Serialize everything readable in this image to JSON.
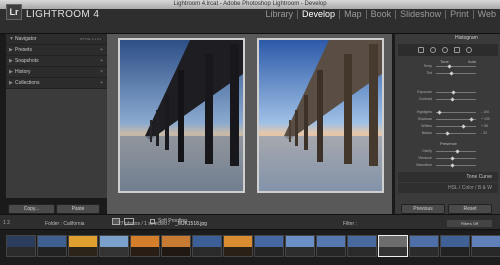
{
  "window": {
    "title": "Lightroom 4.lrcat - Adobe Photoshop Lightroom - Develop"
  },
  "identity": {
    "small": "ADOBE PHOTOSHOP",
    "name": "LIGHTROOM 4",
    "logo": "Lr"
  },
  "modules": [
    {
      "label": "Library",
      "active": false
    },
    {
      "label": "Develop",
      "active": true
    },
    {
      "label": "Map",
      "active": false
    },
    {
      "label": "Book",
      "active": false
    },
    {
      "label": "Slideshow",
      "active": false
    },
    {
      "label": "Print",
      "active": false
    },
    {
      "label": "Web",
      "active": false
    }
  ],
  "left_panel": {
    "navigator": {
      "label": "Navigator",
      "zoom_options": "FIT FILL 1:1 3:1"
    },
    "sections": [
      {
        "label": "Presets"
      },
      {
        "label": "Snapshots"
      },
      {
        "label": "History"
      },
      {
        "label": "Collections"
      }
    ],
    "copy_label": "Copy...",
    "paste_label": "Paste"
  },
  "right_panel": {
    "histogram_label": "Histogram",
    "tone_label": "Tone",
    "auto_label": "Auto",
    "presence_label": "Presence",
    "sliders": [
      {
        "label": "Temp",
        "value": ""
      },
      {
        "label": "Tint",
        "value": ""
      },
      {
        "label": "Exposure",
        "value": ""
      },
      {
        "label": "Contrast",
        "value": ""
      },
      {
        "label": "Highlights",
        "value": "- 100"
      },
      {
        "label": "Shadows",
        "value": "+ 100"
      },
      {
        "label": "Whites",
        "value": "+ 55"
      },
      {
        "label": "Blacks",
        "value": "- 32"
      },
      {
        "label": "Clarity",
        "value": ""
      },
      {
        "label": "Vibrance",
        "value": ""
      },
      {
        "label": "Saturation",
        "value": ""
      }
    ],
    "tone_curve_label": "Tone Curve",
    "hsl_label": "HSL / Color / B & W",
    "previous_label": "Previous",
    "reset_label": "Reset"
  },
  "toolbar": {
    "soft_proofing": "Soft Proofing"
  },
  "filmstrip_bar": {
    "page_nums": "1  2",
    "folder": "Folder : California",
    "count": "27 photos / 1 selected /",
    "file": "_MJK1518.jpg",
    "filter": "Filter :",
    "filters_off": "Filters Off"
  },
  "thumbnails": [
    {
      "sky": "#2a3d5c",
      "ground": "#2b2b2b",
      "selected": false
    },
    {
      "sky": "#3f5f8f",
      "ground": "#222222",
      "selected": false
    },
    {
      "sky": "#e0a030",
      "ground": "#2c2418",
      "selected": false
    },
    {
      "sky": "#7aa0cc",
      "ground": "#333333",
      "selected": false
    },
    {
      "sky": "#d47d2a",
      "ground": "#2a1e14",
      "selected": false
    },
    {
      "sky": "#c77a32",
      "ground": "#211812",
      "selected": false
    },
    {
      "sky": "#3b5f96",
      "ground": "#2a2a2a",
      "selected": false
    },
    {
      "sky": "#d98c30",
      "ground": "#2a2015",
      "selected": false
    },
    {
      "sky": "#4668a2",
      "ground": "#252525",
      "selected": false
    },
    {
      "sky": "#6a8fc4",
      "ground": "#2d2d2d",
      "selected": false
    },
    {
      "sky": "#5678b0",
      "ground": "#262626",
      "selected": false
    },
    {
      "sky": "#496a9e",
      "ground": "#2a2a2a",
      "selected": false
    },
    {
      "sky": "#6d6d6d",
      "ground": "#333333",
      "selected": true
    },
    {
      "sky": "#4e6fa8",
      "ground": "#2b2b2b",
      "selected": false
    },
    {
      "sky": "#3f6196",
      "ground": "#222222",
      "selected": false
    },
    {
      "sky": "#5f80b8",
      "ground": "#282828",
      "selected": false
    }
  ],
  "colors": {
    "accent": "#ffffff",
    "panel": "#3a3a3a",
    "canvas": "#595959"
  }
}
